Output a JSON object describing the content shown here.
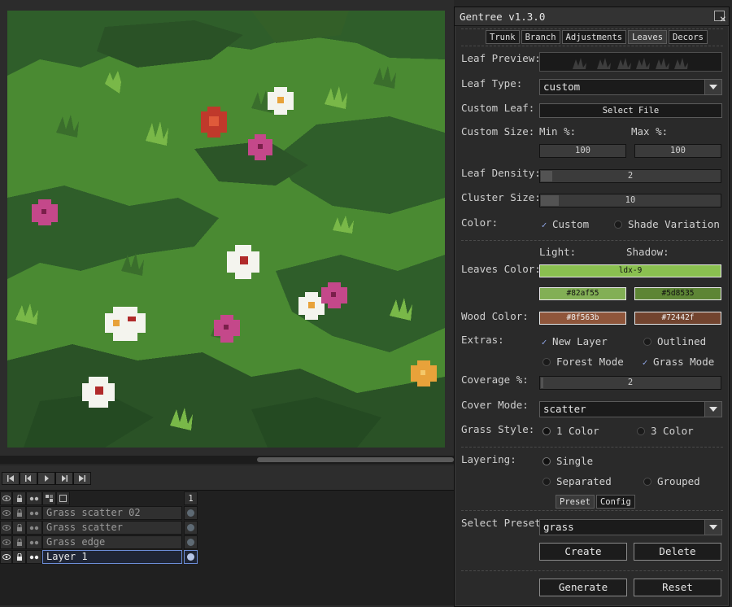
{
  "plugin": {
    "title": "Gentree v1.3.0",
    "tabs": [
      {
        "label": "Trunk",
        "active": false
      },
      {
        "label": "Branch",
        "active": false
      },
      {
        "label": "Adjustments",
        "active": false
      },
      {
        "label": "Leaves",
        "active": true
      },
      {
        "label": "Decors",
        "active": false
      }
    ],
    "leaf_preview_label": "Leaf Preview:",
    "leaf_type": {
      "label": "Leaf Type:",
      "value": "custom"
    },
    "custom_leaf": {
      "label": "Custom Leaf:",
      "button": "Select File"
    },
    "custom_size": {
      "label": "Custom Size:",
      "min_label": "Min %:",
      "max_label": "Max %:",
      "min_value": "100",
      "max_value": "100"
    },
    "leaf_density": {
      "label": "Leaf Density:",
      "value": "2",
      "fraction": 0.07
    },
    "cluster_size": {
      "label": "Cluster Size:",
      "value": "10",
      "fraction": 0.07
    },
    "color": {
      "label": "Color:",
      "custom_label": "Custom",
      "custom_checked": true,
      "shade_label": "Shade Variation",
      "shade_checked": false
    },
    "light_label": "Light:",
    "shadow_label": "Shadow:",
    "leaves_color": {
      "label": "Leaves Color:",
      "palette": "ldx-9",
      "palette_color": "#8ac050",
      "light": "#82af55",
      "shadow": "#5d8535"
    },
    "wood_color": {
      "label": "Wood Color:",
      "light": "#8f563b",
      "shadow": "#72442f"
    },
    "extras": {
      "label": "Extras:",
      "new_layer": {
        "label": "New Layer",
        "checked": true
      },
      "outlined": {
        "label": "Outlined",
        "checked": false
      },
      "forest_mode": {
        "label": "Forest Mode",
        "checked": false
      },
      "grass_mode": {
        "label": "Grass Mode",
        "checked": true
      }
    },
    "coverage": {
      "label": "Coverage %:",
      "value": "2",
      "fraction": 0.01
    },
    "cover_mode": {
      "label": "Cover Mode:",
      "value": "scatter"
    },
    "grass_style": {
      "label": "Grass Style:",
      "opt1": "1 Color",
      "opt2": "3 Color"
    },
    "layering": {
      "label": "Layering:",
      "single": "Single",
      "separated": "Separated",
      "grouped": "Grouped"
    },
    "sub_tabs": [
      {
        "label": "Preset",
        "active": true
      },
      {
        "label": "Config",
        "active": false
      }
    ],
    "select_preset": {
      "label": "Select Preset:",
      "value": "grass"
    },
    "create_label": "Create",
    "delete_label": "Delete",
    "generate_label": "Generate",
    "reset_label": "Reset"
  },
  "timeline": {
    "frame_number": "1",
    "layers": [
      {
        "name": "Grass scatter 02",
        "active": false
      },
      {
        "name": "Grass scatter",
        "active": false
      },
      {
        "name": "Grass edge",
        "active": false
      },
      {
        "name": "Layer 1",
        "active": true
      }
    ]
  },
  "colors": {
    "grass_light": "#5a9a3a",
    "grass_dark": "#2e5a2a",
    "panel_bg": "#2a2a2a",
    "accent_blue": "#6c8dd8"
  },
  "icons": {
    "close": "close-icon",
    "dropdown": "chevron-down-icon",
    "check": "checkmark-icon",
    "eye": "eye-icon",
    "lock": "lock-icon",
    "link": "link-icon",
    "first": "first-frame-icon",
    "prev": "previous-frame-icon",
    "play": "play-icon",
    "next": "next-frame-icon",
    "last": "last-frame-icon"
  }
}
